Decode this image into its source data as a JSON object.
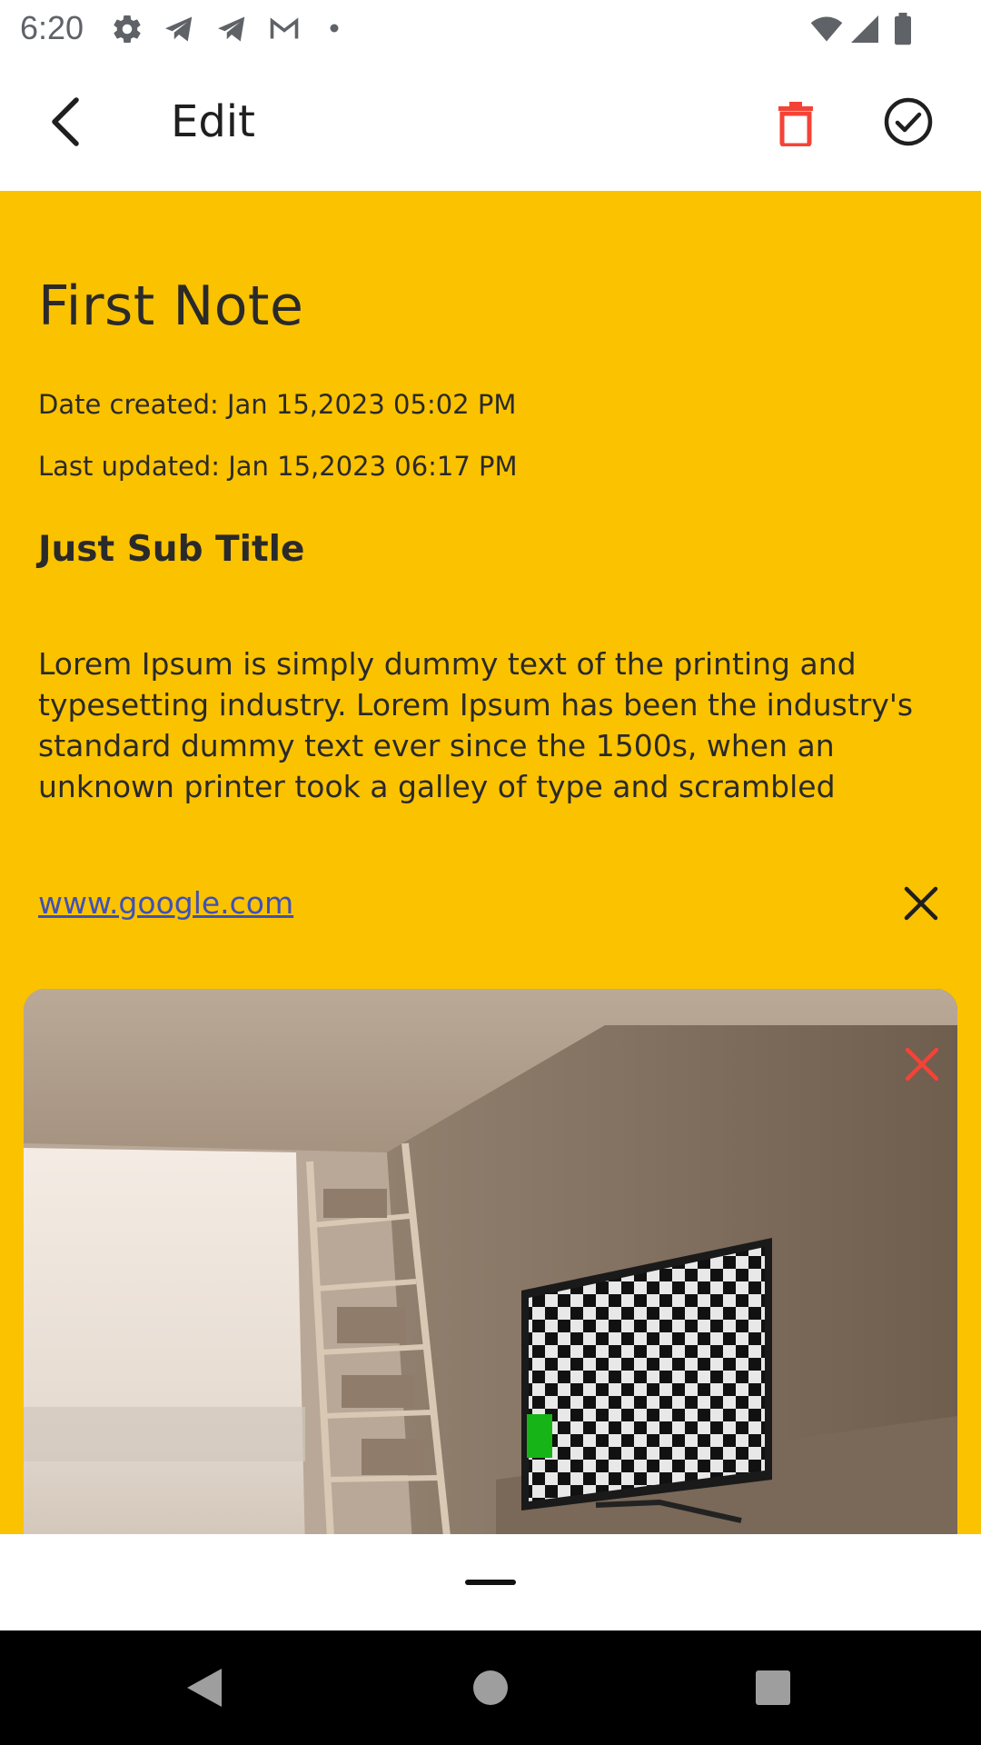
{
  "status_bar": {
    "time": "6:20",
    "left_icons": [
      "gear-icon",
      "telegram-icon",
      "telegram-icon",
      "gmail-icon",
      "dot-icon"
    ],
    "right_icons": [
      "wifi-icon",
      "cell-signal-icon",
      "battery-icon"
    ]
  },
  "app_bar": {
    "title": "Edit",
    "back_icon": "chevron-left-icon",
    "delete_icon": "trash-icon",
    "save_icon": "check-circle-icon",
    "delete_color": "#f44336"
  },
  "note": {
    "title": "First Note",
    "date_created": "Date created: Jan 15,2023  05:02 PM",
    "last_updated": "Last updated: Jan 15,2023  06:17 PM",
    "subtitle": "Just Sub Title",
    "body": "Lorem Ipsum is simply dummy text of the printing and typesetting industry. Lorem Ipsum has been the industry's standard dummy text ever since the 1500s, when an unknown printer took a galley of type and scrambled",
    "link": "www.google.com",
    "background_color": "#fbc200"
  },
  "image": {
    "remove_icon": "close-icon",
    "remove_color": "#f44336"
  },
  "nav_bar": {
    "buttons": [
      "back-triangle-icon",
      "home-circle-icon",
      "recents-square-icon"
    ]
  }
}
